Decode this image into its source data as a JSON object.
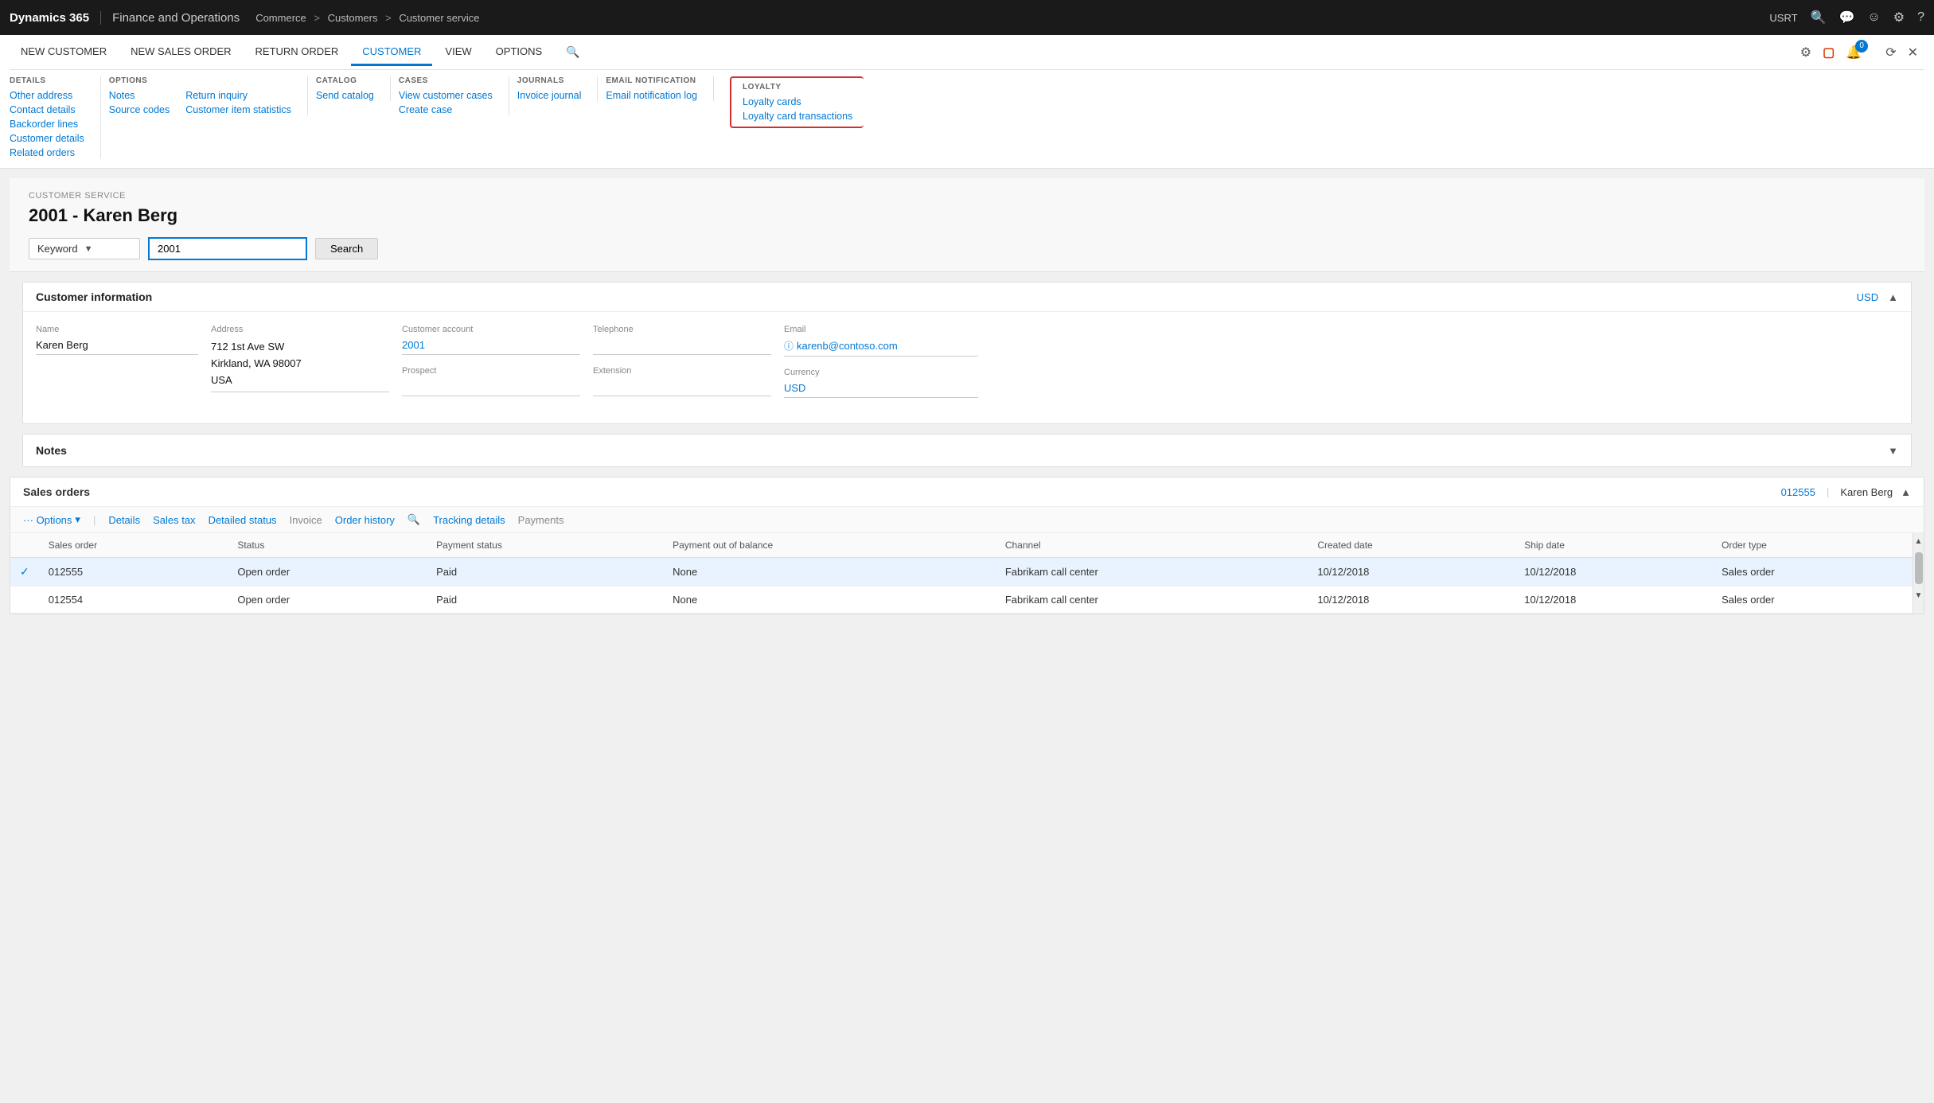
{
  "topNav": {
    "brand": "Dynamics 365",
    "appName": "Finance and Operations",
    "breadcrumb": [
      "Commerce",
      "Customers",
      "Customer service"
    ],
    "userLabel": "USRT"
  },
  "ribbonTabs": [
    {
      "label": "New customer",
      "active": false
    },
    {
      "label": "New sales order",
      "active": false
    },
    {
      "label": "Return order",
      "active": false
    },
    {
      "label": "CUSTOMER",
      "active": true
    },
    {
      "label": "VIEW",
      "active": false
    },
    {
      "label": "OPTIONS",
      "active": false
    }
  ],
  "ribbonGroups": {
    "details": {
      "title": "DETAILS",
      "items": [
        "Other address",
        "Contact details",
        "Backorder lines",
        "Customer details",
        "Related orders"
      ]
    },
    "options": {
      "title": "OPTIONS",
      "col1": [
        "Notes",
        "Source codes"
      ],
      "col2": [
        "Return inquiry",
        "Customer item statistics"
      ]
    },
    "catalog": {
      "title": "CATALOG",
      "items": [
        "Send catalog"
      ]
    },
    "cases": {
      "title": "CASES",
      "items": [
        "View customer cases",
        "Create case"
      ]
    },
    "journals": {
      "title": "JOURNALS",
      "items": [
        "Invoice journal"
      ]
    },
    "emailNotification": {
      "title": "EMAIL NOTIFICATION",
      "items": [
        "Email notification log"
      ]
    },
    "loyalty": {
      "title": "LOYALTY",
      "items": [
        "Loyalty cards",
        "Loyalty card transactions"
      ]
    }
  },
  "customerService": {
    "label": "CUSTOMER SERVICE",
    "title": "2001 - Karen Berg",
    "search": {
      "keywordLabel": "Keyword",
      "inputValue": "2001",
      "buttonLabel": "Search"
    }
  },
  "customerInfo": {
    "sectionTitle": "Customer information",
    "currencyLink": "USD",
    "fields": {
      "nameLabel": "Name",
      "nameValue": "Karen Berg",
      "addressLabel": "Address",
      "addressLine1": "712 1st Ave SW",
      "addressLine2": "Kirkland, WA 98007",
      "addressLine3": "USA",
      "accountLabel": "Customer account",
      "accountValue": "2001",
      "prospectLabel": "Prospect",
      "prospectValue": "",
      "telephoneLabel": "Telephone",
      "telephoneValue": "",
      "extensionLabel": "Extension",
      "extensionValue": "",
      "emailLabel": "Email",
      "emailValue": "karenb@contoso.com",
      "currencyLabel": "Currency",
      "currencyValue": "USD"
    }
  },
  "notes": {
    "sectionTitle": "Notes"
  },
  "salesOrders": {
    "sectionTitle": "Sales orders",
    "orderNumLink": "012555",
    "customerName": "Karen Berg",
    "toolbar": {
      "options": "··· Options",
      "optionsChev": "▾",
      "details": "Details",
      "salesTax": "Sales tax",
      "detailedStatus": "Detailed status",
      "invoice": "Invoice",
      "orderHistory": "Order history",
      "trackingDetails": "Tracking details",
      "payments": "Payments"
    },
    "tableHeaders": [
      "Sales order",
      "Status",
      "Payment status",
      "Payment out of balance",
      "Channel",
      "Created date",
      "Ship date",
      "Order type"
    ],
    "rows": [
      {
        "salesOrder": "012555",
        "status": "Open order",
        "paymentStatus": "Paid",
        "paymentBalance": "None",
        "channel": "Fabrikam call center",
        "createdDate": "10/12/2018",
        "shipDate": "10/12/2018",
        "orderType": "Sales order",
        "selected": true
      },
      {
        "salesOrder": "012554",
        "status": "Open order",
        "paymentStatus": "Paid",
        "paymentBalance": "None",
        "channel": "Fabrikam call center",
        "createdDate": "10/12/2018",
        "shipDate": "10/12/2018",
        "orderType": "Sales order",
        "selected": false
      }
    ]
  }
}
